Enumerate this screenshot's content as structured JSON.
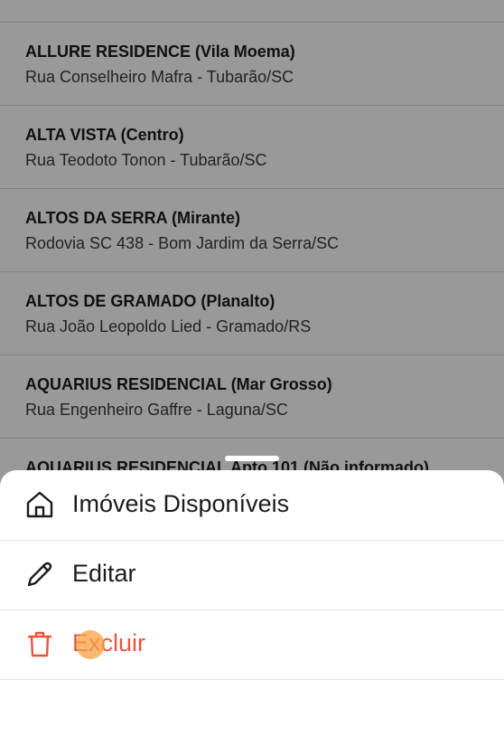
{
  "list": {
    "items": [
      {
        "title": "ALLURE RESIDENCE (Vila Moema)",
        "address": "Rua Conselheiro Mafra - Tubarão/SC"
      },
      {
        "title": "ALTA VISTA (Centro)",
        "address": "Rua Teodoto Tonon  - Tubarão/SC"
      },
      {
        "title": "ALTOS DA SERRA (Mirante)",
        "address": "Rodovia SC 438  - Bom Jardim da Serra/SC"
      },
      {
        "title": "ALTOS DE GRAMADO (Planalto)",
        "address": "Rua João Leopoldo Lied - Gramado/RS"
      },
      {
        "title": "AQUARIUS RESIDENCIAL (Mar Grosso)",
        "address": "Rua Engenheiro Gaffre - Laguna/SC"
      },
      {
        "title": "AQUARIUS RESIDENCIAL Apto 101 (Não informado)",
        "address": ""
      }
    ]
  },
  "sheet": {
    "actions": [
      {
        "label": "Imóveis Disponíveis",
        "icon": "home-icon"
      },
      {
        "label": "Editar",
        "icon": "pencil-icon"
      },
      {
        "label": "Excluir",
        "icon": "trash-icon"
      }
    ],
    "danger_color": "#e8553d"
  }
}
